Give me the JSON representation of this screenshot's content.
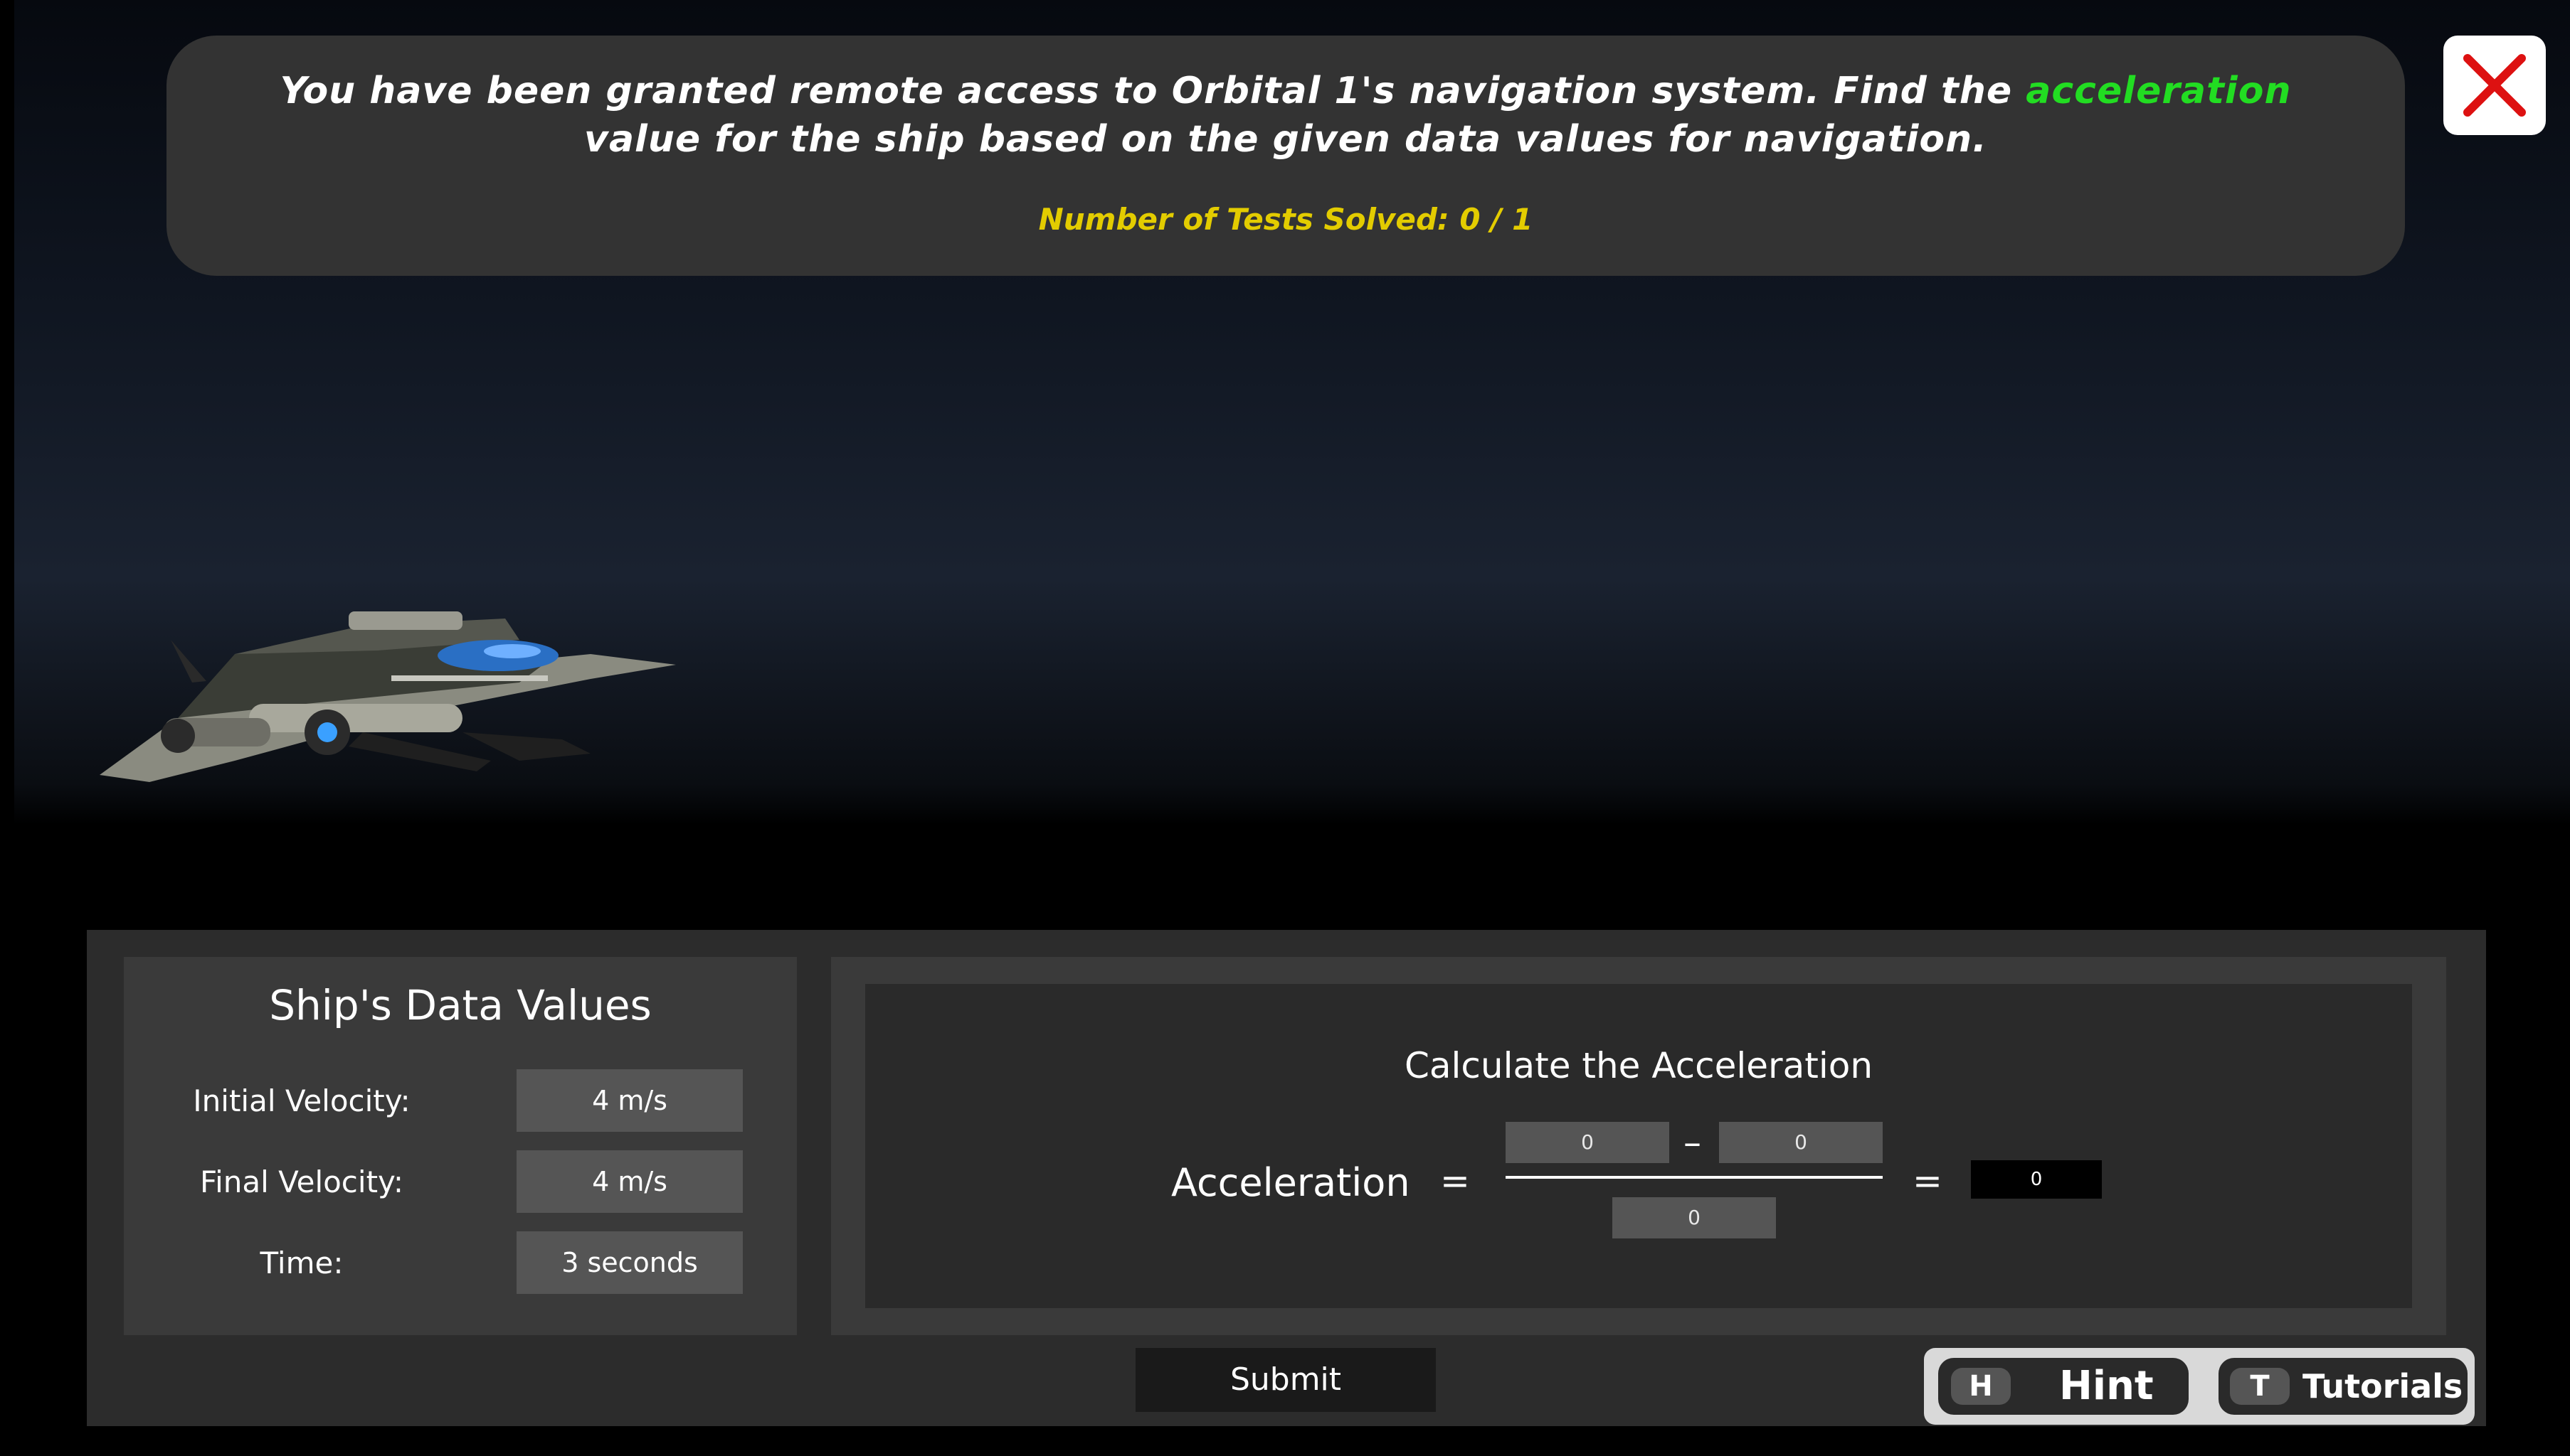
{
  "banner": {
    "text_before": "You have been granted remote access to Orbital 1's navigation system. Find the ",
    "highlight": "acceleration",
    "text_after": " value for the ship based on the given data values for navigation.",
    "tests_solved": "Number of Tests Solved: 0 / 1",
    "close_icon": "close-x-icon"
  },
  "data_values": {
    "title": "Ship's Data Values",
    "rows": [
      {
        "label": "Initial Velocity:",
        "value": "4 m/s"
      },
      {
        "label": "Final Velocity:",
        "value": "4 m/s"
      },
      {
        "label": "Time:",
        "value": "3 seconds"
      }
    ]
  },
  "calculator": {
    "title": "Calculate the Acceleration",
    "label": "Acceleration",
    "equals": "=",
    "minus": "–",
    "numerator_left": "0",
    "numerator_right": "0",
    "denominator": "0",
    "result": "0"
  },
  "submit_label": "Submit",
  "help": {
    "hint_key": "H",
    "hint_label": "Hint",
    "tutorials_key": "T",
    "tutorials_label": "Tutorials"
  },
  "colors": {
    "highlight": "#22dd22",
    "tests": "#e3cc00",
    "close": "#dd1111"
  }
}
